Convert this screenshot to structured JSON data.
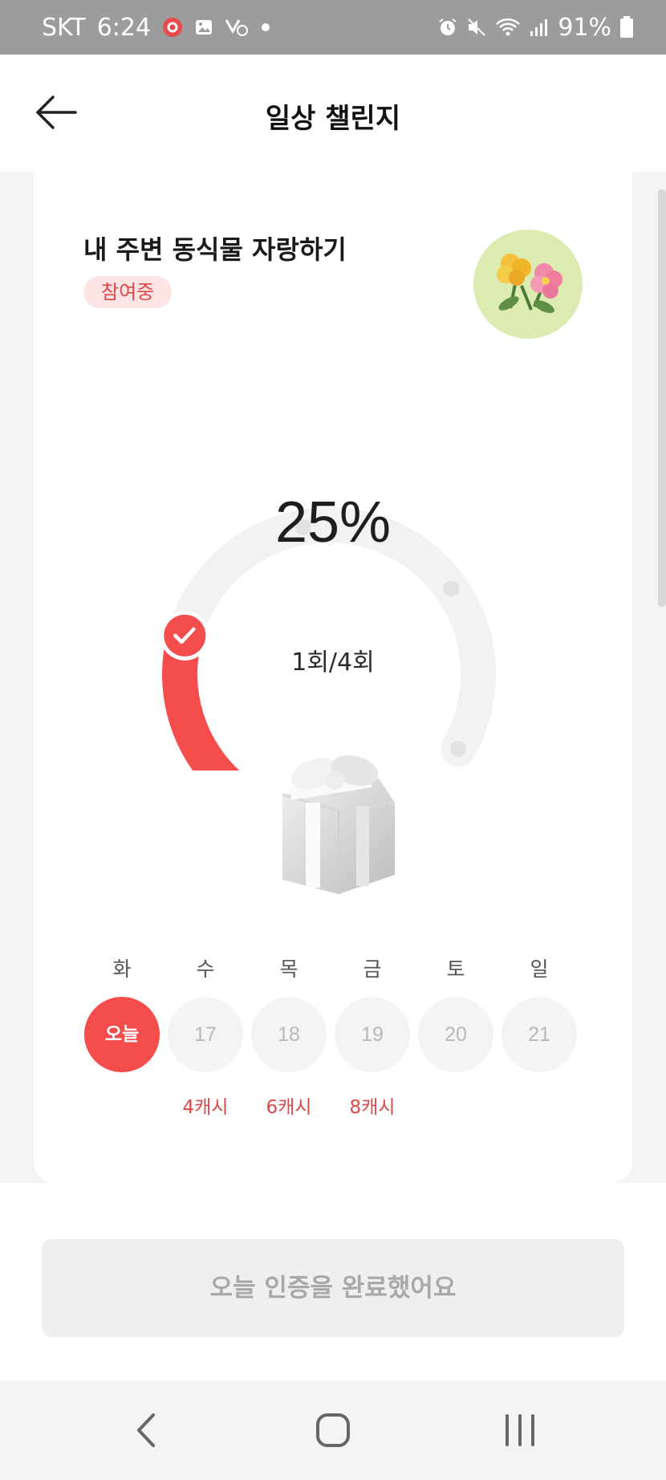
{
  "status_bar": {
    "carrier": "SKT",
    "time": "6:24",
    "battery": "91%"
  },
  "header": {
    "title": "일상 챌린지"
  },
  "challenge": {
    "title": "내 주변 동식물 자랑하기",
    "status": "참여중",
    "progress_percent_text": "25%",
    "progress_fraction": 0.25,
    "count_text": "1회/4회"
  },
  "week": {
    "days": [
      "화",
      "수",
      "목",
      "금",
      "토",
      "일"
    ],
    "dates": [
      "오늘",
      "17",
      "18",
      "19",
      "20",
      "21"
    ],
    "rewards": [
      "",
      "4캐시",
      "6캐시",
      "8캐시",
      "",
      ""
    ]
  },
  "complete_button": {
    "label": "오늘 인증을 완료했어요"
  },
  "colors": {
    "accent": "#f54c4c",
    "badge_bg": "#fde4e4",
    "track": "#f2f2f2"
  }
}
